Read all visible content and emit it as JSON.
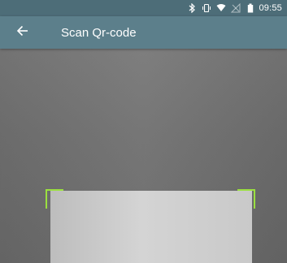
{
  "status_bar": {
    "time": "09:55",
    "icons": [
      "bluetooth-icon",
      "vibrate-icon",
      "wifi-icon",
      "no-signal-icon",
      "battery-icon"
    ]
  },
  "app_bar": {
    "title": "Scan Qr-code",
    "back_icon": "arrow-left-icon"
  },
  "colors": {
    "status_bar": "#4d6d78",
    "app_bar": "#5c7f8b",
    "scan_corner": "#9be040"
  }
}
